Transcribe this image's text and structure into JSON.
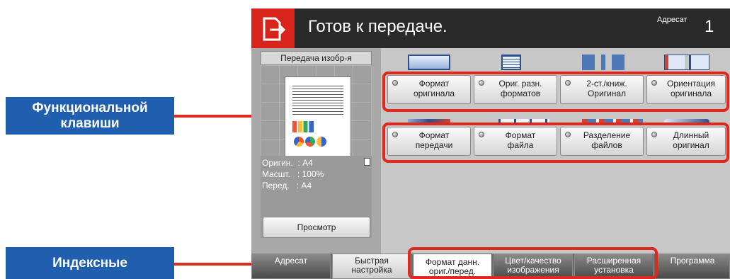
{
  "header": {
    "title": "Готов к передаче.",
    "dest_label": "Адресат",
    "dest_count": "1"
  },
  "preview": {
    "title": "Передача изобр-я",
    "orig": "Оригин.  : A4",
    "scale": "Масшт.   : 100%",
    "send": "Перед.   : A4",
    "preview_button": "Просмотр"
  },
  "function_keys": [
    "Формат\nоригинала",
    "Ориг. разн.\nформатов",
    "2-ст./книж.\nОригинал",
    "Ориентация\nоригинала",
    "Формат\nпередачи",
    "Формат\nфайла",
    "Разделение\nфайлов",
    "Длинный\nоригинал"
  ],
  "tabs": {
    "destination": "Адресат",
    "quick": "Быстрая\nнастройка",
    "orig_format": "Формат данн.\nориг./перед.",
    "color_quality": "Цвет/качество\nизображения",
    "advanced": "Расширенная\nустановка",
    "program": "Программа"
  },
  "callouts": {
    "function_keys": "Функциональной\nклавиши",
    "index_tabs": "Индексные"
  },
  "colors": {
    "callout_blue": "#1f5fad",
    "highlight_red": "#e0281c",
    "top_bar": "#2a2a2a"
  }
}
